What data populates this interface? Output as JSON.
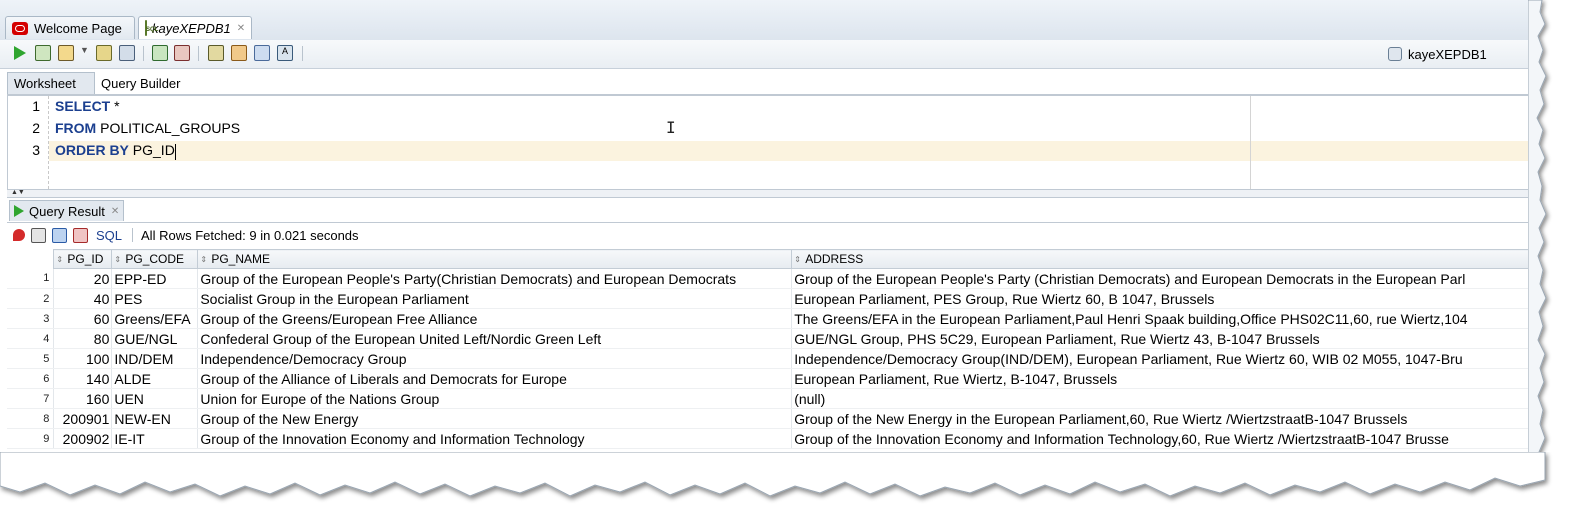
{
  "tabs": [
    {
      "label": "Welcome Page",
      "icon": "oracle-icon"
    },
    {
      "label": "kayeXEPDB1",
      "icon": "sql-worksheet-icon",
      "active": true
    }
  ],
  "toolbar": {
    "connection": "kayeXEPDB1"
  },
  "subtabs": {
    "worksheet": "Worksheet",
    "query_builder": "Query Builder"
  },
  "editor": {
    "lines": [
      {
        "num": "1",
        "keyword": "SELECT",
        "rest": " *"
      },
      {
        "num": "2",
        "keyword": "FROM",
        "rest": " POLITICAL_GROUPS"
      },
      {
        "num": "3",
        "keyword": "ORDER BY",
        "rest": " PG_ID"
      }
    ]
  },
  "result": {
    "tab_label": "Query Result",
    "sql_label": "SQL",
    "status": "All Rows Fetched: 9 in 0.021 seconds",
    "columns": [
      "PG_ID",
      "PG_CODE",
      "PG_NAME",
      "ADDRESS"
    ],
    "rows": [
      [
        "1",
        "20",
        "EPP-ED",
        "Group of the European People's Party(Christian Democrats) and European Democrats",
        "Group of the European People's Party (Christian Democrats) and European Democrats in the European Parl"
      ],
      [
        "2",
        "40",
        "PES",
        "Socialist Group in the European Parliament",
        "European Parliament, PES Group, Rue Wiertz 60, B 1047, Brussels"
      ],
      [
        "3",
        "60",
        "Greens/EFA",
        "Group of the Greens/European Free Alliance",
        "The Greens/EFA in the European Parliament,Paul Henri Spaak building,Office PHS02C11,60, rue Wiertz,104"
      ],
      [
        "4",
        "80",
        "GUE/NGL",
        "Confederal Group of the European United Left/Nordic Green Left",
        "GUE/NGL Group, PHS 5C29, European Parliament, Rue Wiertz 43, B-1047 Brussels"
      ],
      [
        "5",
        "100",
        "IND/DEM",
        "Independence/Democracy Group",
        "Independence/Democracy Group(IND/DEM), European Parliament, Rue Wiertz 60, WIB 02 M055, 1047-Bru"
      ],
      [
        "6",
        "140",
        "ALDE",
        "Group of the Alliance of Liberals and Democrats for Europe",
        "European Parliament, Rue Wiertz, B-1047, Brussels"
      ],
      [
        "7",
        "160",
        "UEN",
        "Union for Europe of the Nations Group",
        "(null)"
      ],
      [
        "8",
        "200901",
        "NEW-EN",
        "Group of the New Energy",
        "Group of the New Energy in the European Parliament,60, Rue Wiertz /WiertzstraatB-1047 Brussels"
      ],
      [
        "9",
        "200902",
        "IE-IT",
        "Group of the Innovation Economy and Information Technology",
        "Group of the Innovation Economy and Information Technology,60, Rue Wiertz /WiertzstraatB-1047 Brusse"
      ]
    ]
  }
}
